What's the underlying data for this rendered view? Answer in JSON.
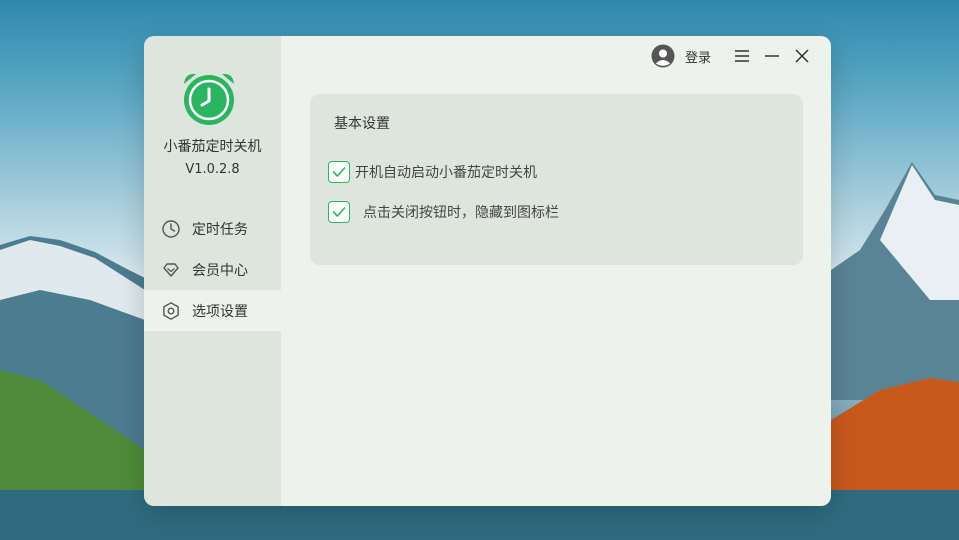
{
  "app": {
    "name": "小番茄定时关机",
    "version": "V1.0.2.8"
  },
  "sidebar": {
    "items": [
      {
        "label": "定时任务",
        "icon": "clock-icon",
        "active": false
      },
      {
        "label": "会员中心",
        "icon": "diamond-icon",
        "active": false
      },
      {
        "label": "选项设置",
        "icon": "settings-icon",
        "active": true
      }
    ]
  },
  "topbar": {
    "login_label": "登录",
    "icons": [
      "user-avatar-icon",
      "menu-icon",
      "minimize-icon",
      "close-icon"
    ]
  },
  "settings": {
    "section_title": "基本设置",
    "options": [
      {
        "label": "开机自动启动小番茄定时关机",
        "checked": true
      },
      {
        "label": "点击关闭按钮时，隐藏到图标栏",
        "checked": true
      }
    ]
  },
  "colors": {
    "accent_green": "#2db461",
    "sidebar_bg": "#dde6dd",
    "main_bg": "#edf2ed",
    "card_bg": "#dce6dc"
  }
}
